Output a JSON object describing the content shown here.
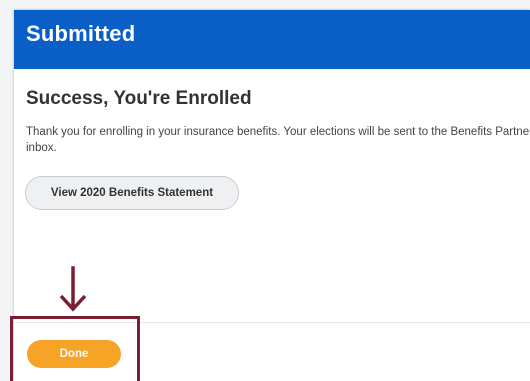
{
  "header": {
    "title": "Submitted"
  },
  "content": {
    "heading": "Success, You're Enrolled",
    "message": "Thank you for enrolling in your insurance benefits. Your elections will be sent to the Benefits Partner inbox.",
    "statement_button_label": "View 2020 Benefits Statement"
  },
  "footer": {
    "done_label": "Done"
  },
  "colors": {
    "header_bg": "#0a5fc7",
    "done_button": "#f7a325",
    "annotation": "#7a1f32"
  },
  "icons": {
    "annotation_arrow": "down-arrow-icon"
  }
}
